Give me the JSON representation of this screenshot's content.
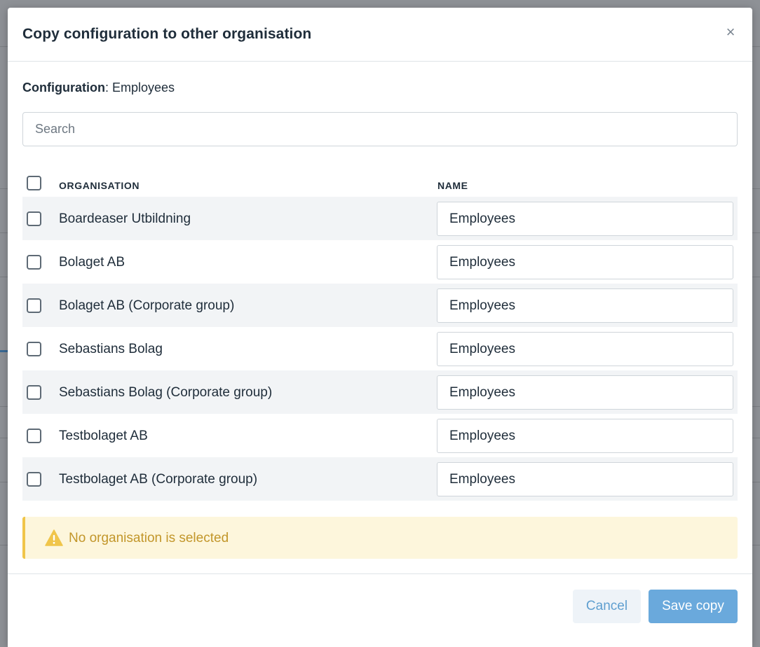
{
  "dialog": {
    "title": "Copy configuration to other organisation",
    "close_glyph": "×",
    "config_label": "Configuration",
    "config_value": "Employees",
    "search_placeholder": "Search",
    "columns": {
      "organisation": "ORGANISATION",
      "name": "NAME"
    },
    "rows": [
      {
        "organisation": "Boardeaser Utbildning",
        "name": "Employees"
      },
      {
        "organisation": "Bolaget AB",
        "name": "Employees"
      },
      {
        "organisation": "Bolaget AB (Corporate group)",
        "name": "Employees"
      },
      {
        "organisation": "Sebastians Bolag",
        "name": "Employees"
      },
      {
        "organisation": "Sebastians Bolag (Corporate group)",
        "name": "Employees"
      },
      {
        "organisation": "Testbolaget AB",
        "name": "Employees"
      },
      {
        "organisation": "Testbolaget AB (Corporate group)",
        "name": "Employees"
      }
    ],
    "warning": {
      "icon": "warning-icon",
      "text": "No organisation is selected"
    },
    "footer": {
      "cancel_label": "Cancel",
      "save_label": "Save copy"
    }
  },
  "colors": {
    "accent": "#6aa9dc",
    "warning_bg": "#fdf6dc",
    "warning_text": "#c2962a",
    "row_shade": "#f2f4f6"
  }
}
